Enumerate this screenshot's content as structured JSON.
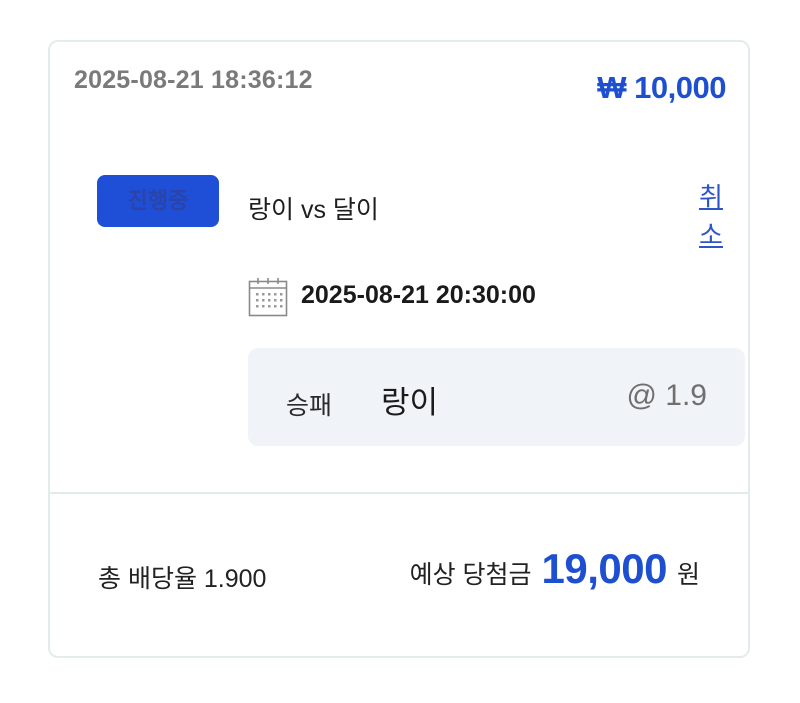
{
  "bet": {
    "placed_at": "2025-08-21 18:36:12",
    "amount": "₩ 10,000",
    "status": "진행중",
    "match": "랑이 vs 달이",
    "cancel_label": "취소",
    "match_datetime": "2025-08-21 20:30:00",
    "market": "승패",
    "pick": "랑이",
    "odds": "@ 1.9"
  },
  "summary": {
    "total_odds": "총 배당율 1.900",
    "payout_label": "예상 당첨금",
    "payout_value": "19,000",
    "payout_unit": "원"
  },
  "colors": {
    "accent": "#1f4fd1",
    "badge_bg": "#1e4fd6",
    "border": "#e4ecea",
    "pick_bg": "#f0f3f8"
  },
  "icons": {
    "calendar": "calendar-icon"
  }
}
